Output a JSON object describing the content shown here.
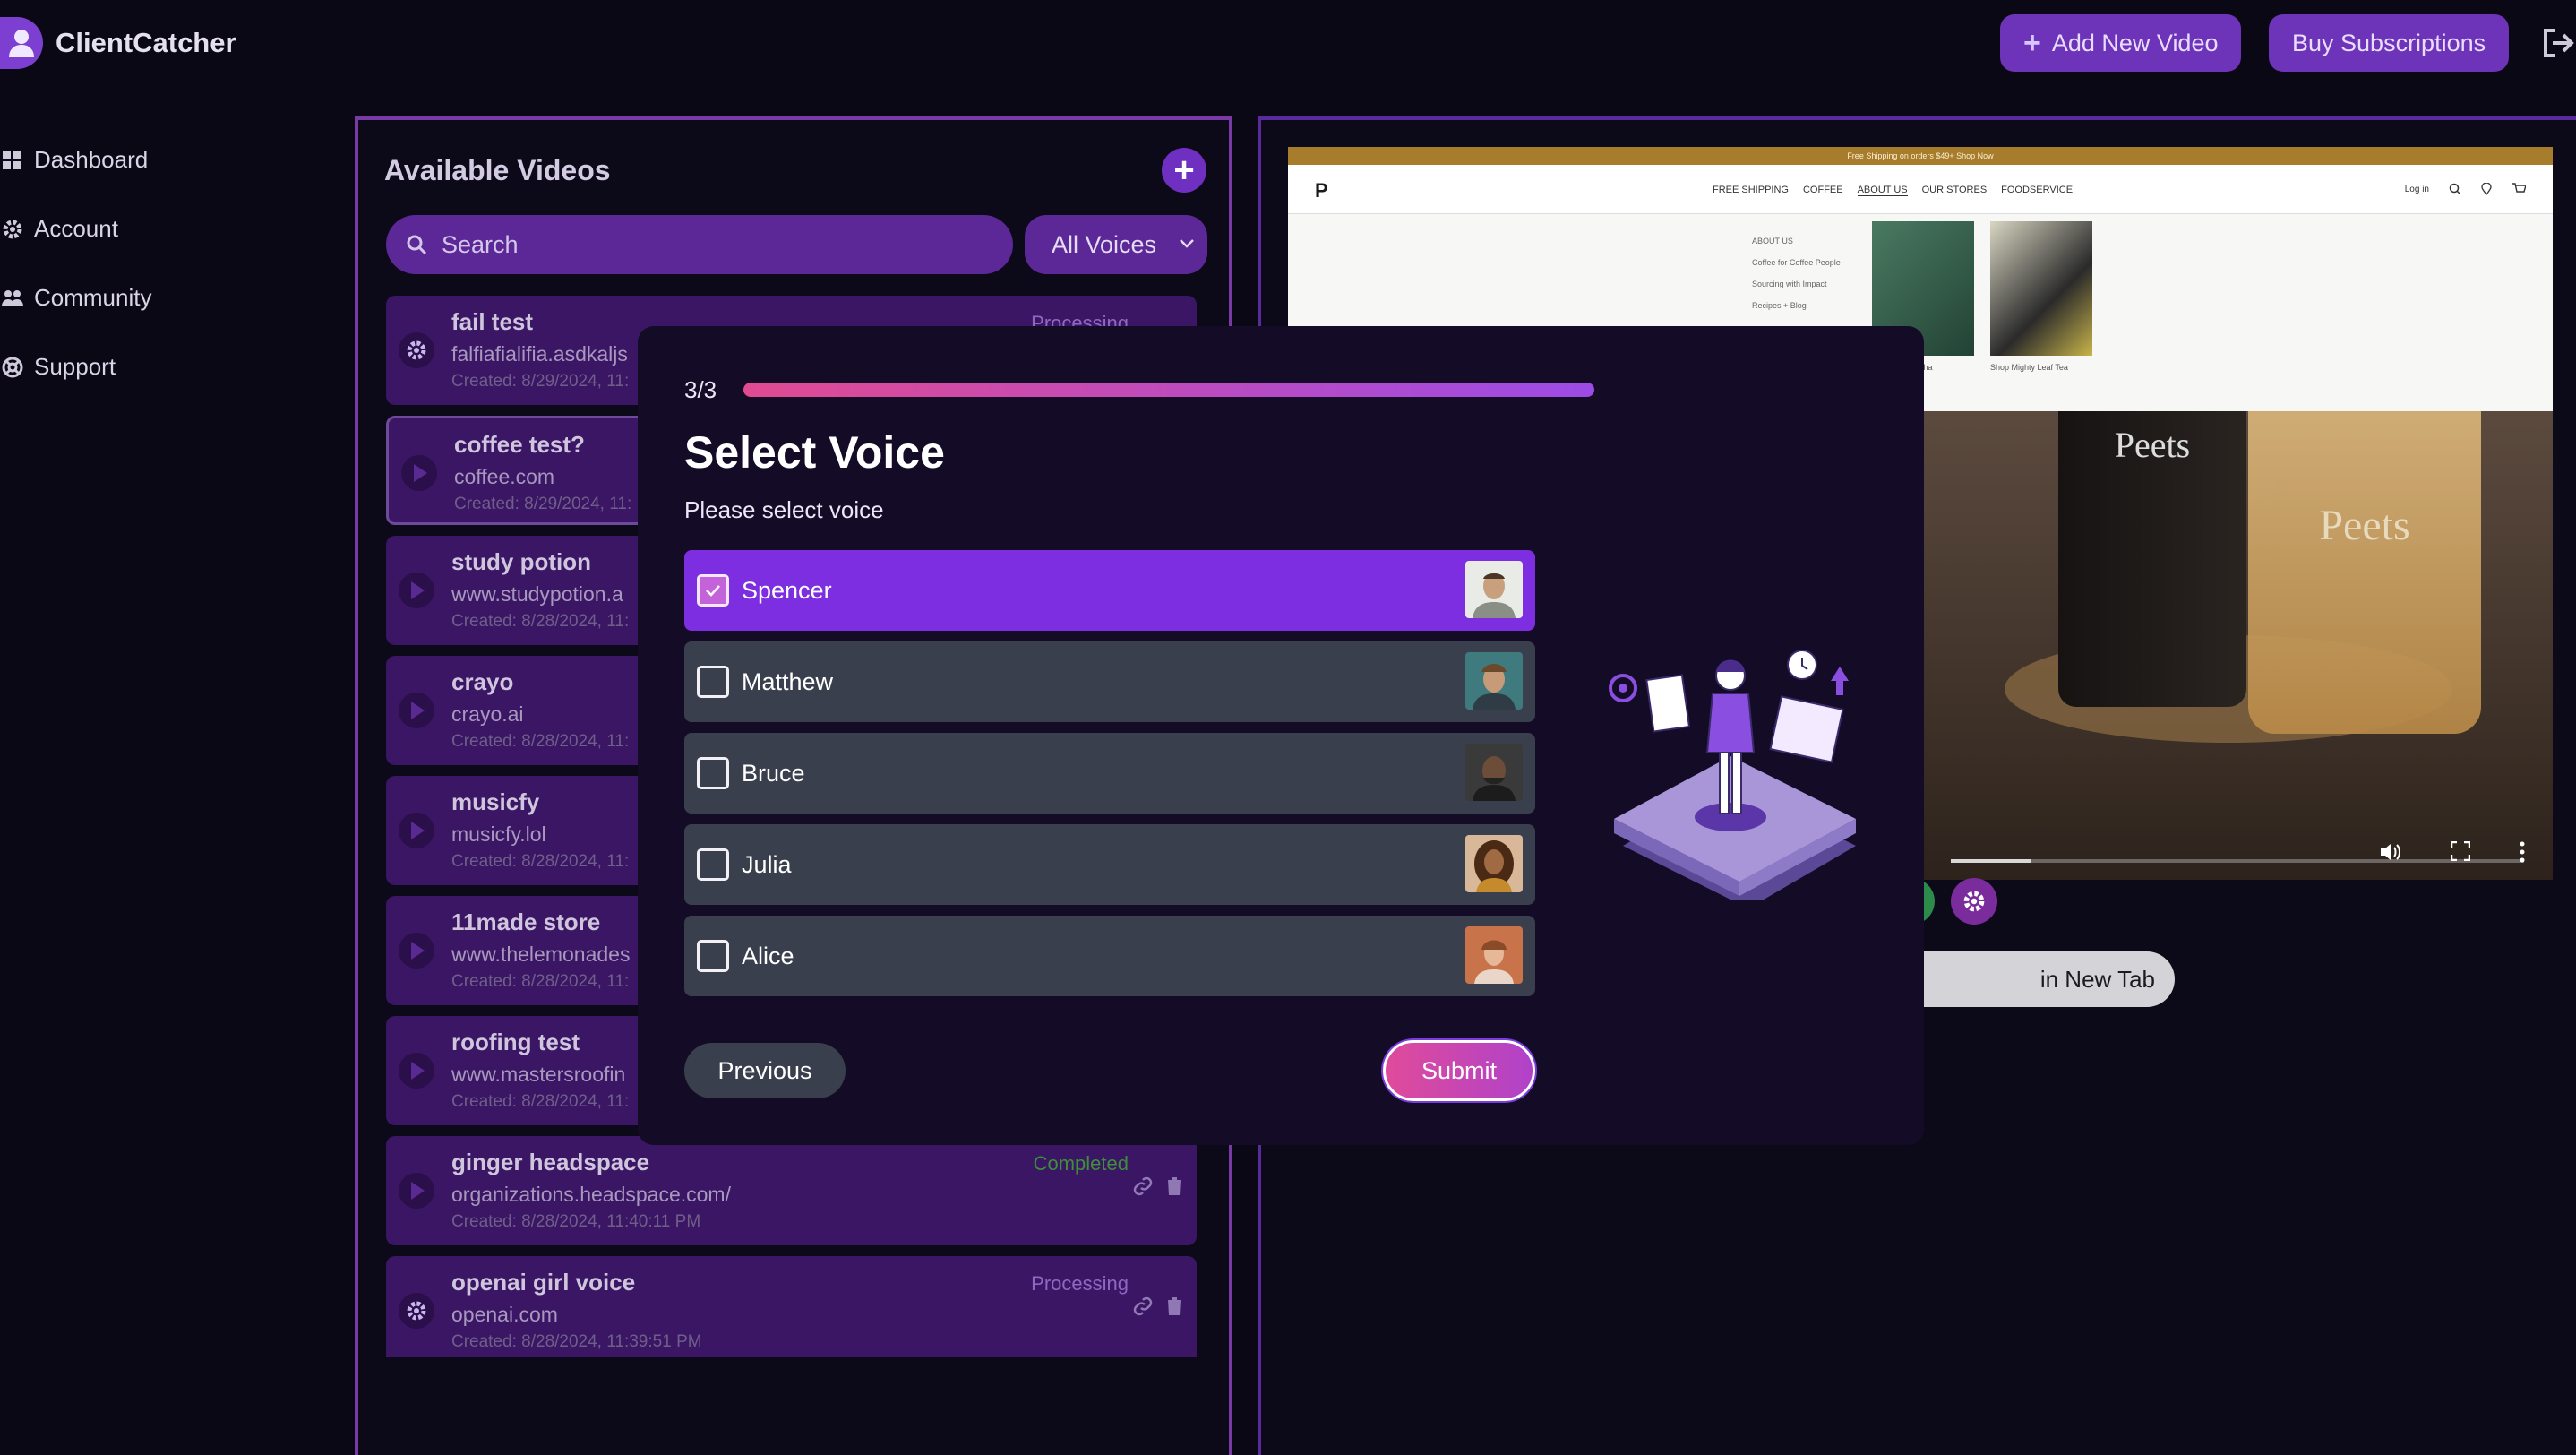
{
  "app": {
    "name": "ClientCatcher"
  },
  "header": {
    "add_video": "Add New Video",
    "buy_subscriptions": "Buy Subscriptions"
  },
  "sidebar": {
    "items": [
      {
        "label": "Dashboard",
        "icon": "grid-icon"
      },
      {
        "label": "Account",
        "icon": "gear-icon"
      },
      {
        "label": "Community",
        "icon": "users-icon"
      },
      {
        "label": "Support",
        "icon": "lifebuoy-icon"
      }
    ]
  },
  "videos": {
    "title": "Available Videos",
    "search_placeholder": "Search",
    "filter": "All Voices",
    "items": [
      {
        "title": "fail test",
        "url": "falfiafialifia.asdkaljs",
        "date": "Created: 8/29/2024, 11:",
        "status": "Processing",
        "state": "processing"
      },
      {
        "title": "coffee test?",
        "url": "coffee.com",
        "date": "Created: 8/29/2024, 11:",
        "status": "",
        "state": "play"
      },
      {
        "title": "study potion",
        "url": "www.studypotion.a",
        "date": "Created: 8/28/2024, 11:",
        "status": "",
        "state": "play"
      },
      {
        "title": "crayo",
        "url": "crayo.ai",
        "date": "Created: 8/28/2024, 11:",
        "status": "",
        "state": "play"
      },
      {
        "title": "musicfy",
        "url": "musicfy.lol",
        "date": "Created: 8/28/2024, 11:",
        "status": "",
        "state": "play"
      },
      {
        "title": "11made store",
        "url": "www.thelemonades",
        "date": "Created: 8/28/2024, 11:",
        "status": "",
        "state": "play"
      },
      {
        "title": "roofing test",
        "url": "www.mastersroofin",
        "date": "Created: 8/28/2024, 11:",
        "status": "",
        "state": "play"
      },
      {
        "title": "ginger headspace",
        "url": "organizations.headspace.com/",
        "date": "Created: 8/28/2024, 11:40:11 PM",
        "status": "Completed",
        "state": "play"
      },
      {
        "title": "openai girl voice",
        "url": "openai.com",
        "date": "Created: 8/28/2024, 11:39:51 PM",
        "status": "Processing",
        "state": "processing"
      }
    ]
  },
  "preview": {
    "promo": "Free Shipping on orders $49+ Shop Now",
    "logo": "P",
    "nav": [
      "FREE SHIPPING",
      "COFFEE",
      "ABOUT US",
      "OUR STORES",
      "FOODSERVICE"
    ],
    "login": "Log in",
    "mega_heading": "ABOUT US",
    "mega_links": [
      "Coffee for Coffee People",
      "Sourcing with Impact",
      "Recipes + Blog"
    ],
    "product1_caption": "Matcha",
    "product2_caption": "Shop Mighty Leaf Tea",
    "cup1_brand": "Peets",
    "cup2_brand": "Peets",
    "open_tab": "in New Tab"
  },
  "modal": {
    "step": "3/3",
    "progress": 1.0,
    "title": "Select Voice",
    "subtitle": "Please select voice",
    "voices": [
      {
        "name": "Spencer",
        "selected": true
      },
      {
        "name": "Matthew",
        "selected": false
      },
      {
        "name": "Bruce",
        "selected": false
      },
      {
        "name": "Julia",
        "selected": false
      },
      {
        "name": "Alice",
        "selected": false
      }
    ],
    "previous": "Previous",
    "submit": "Submit"
  },
  "colors": {
    "accent": "#7c2ee0",
    "processing": "#8f68c2",
    "completed": "#3f8f3a",
    "background": "#0b0816"
  }
}
